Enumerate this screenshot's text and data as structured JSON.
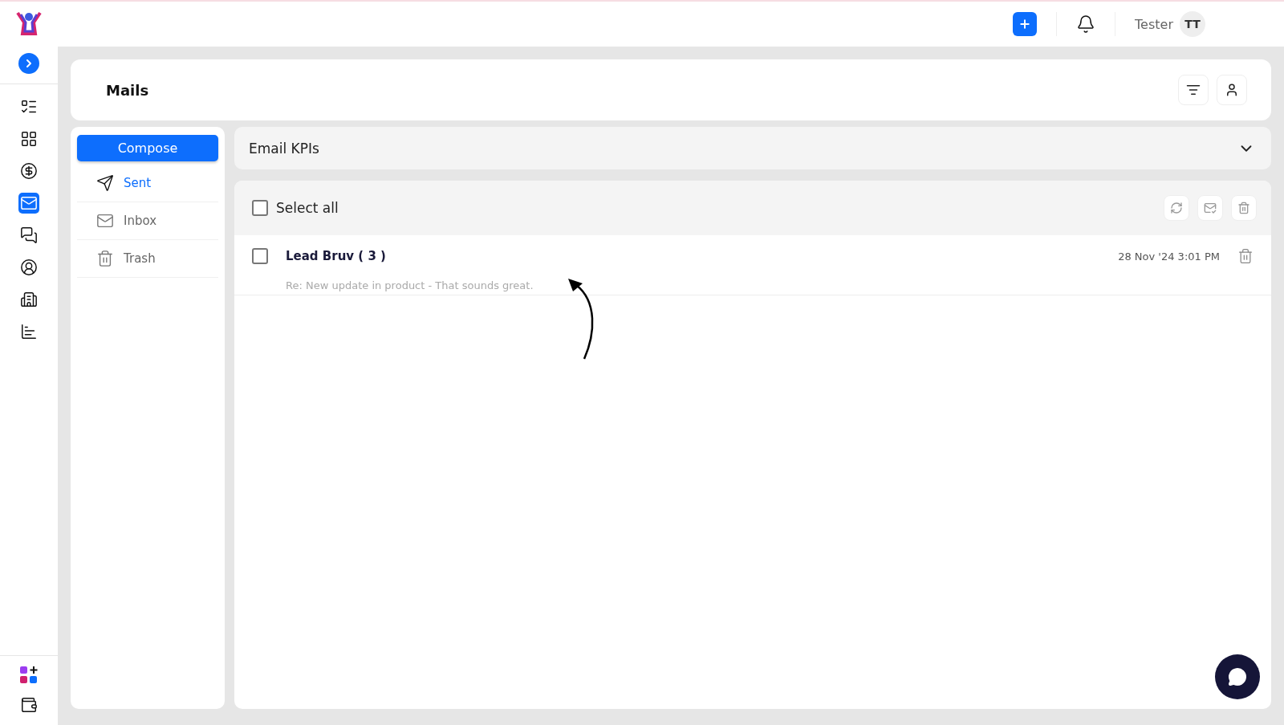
{
  "top_bar": {
    "user_name": "Tester",
    "avatar_initials": "TT"
  },
  "nav_rail": [
    {
      "selected": false
    },
    {
      "selected": false
    },
    {
      "selected": false
    },
    {
      "selected": true
    },
    {
      "selected": false
    },
    {
      "selected": false
    },
    {
      "selected": false
    },
    {
      "selected": false
    }
  ],
  "page_title": "Mails",
  "compose_button": "Compose",
  "folders": [
    {
      "label": "Sent",
      "selected": true
    },
    {
      "label": "Inbox",
      "selected": false
    },
    {
      "label": "Trash",
      "selected": false
    }
  ],
  "kpi_panel": {
    "title": "Email KPIs",
    "expanded": false
  },
  "select_all": {
    "label": "Select all",
    "checked": false
  },
  "emails": [
    {
      "sender": "Lead Bruv ( 3 )",
      "preview": "Re: New update in product -  That sounds great.",
      "date": "28 Nov '24 3:01 PM",
      "checked": false
    }
  ]
}
